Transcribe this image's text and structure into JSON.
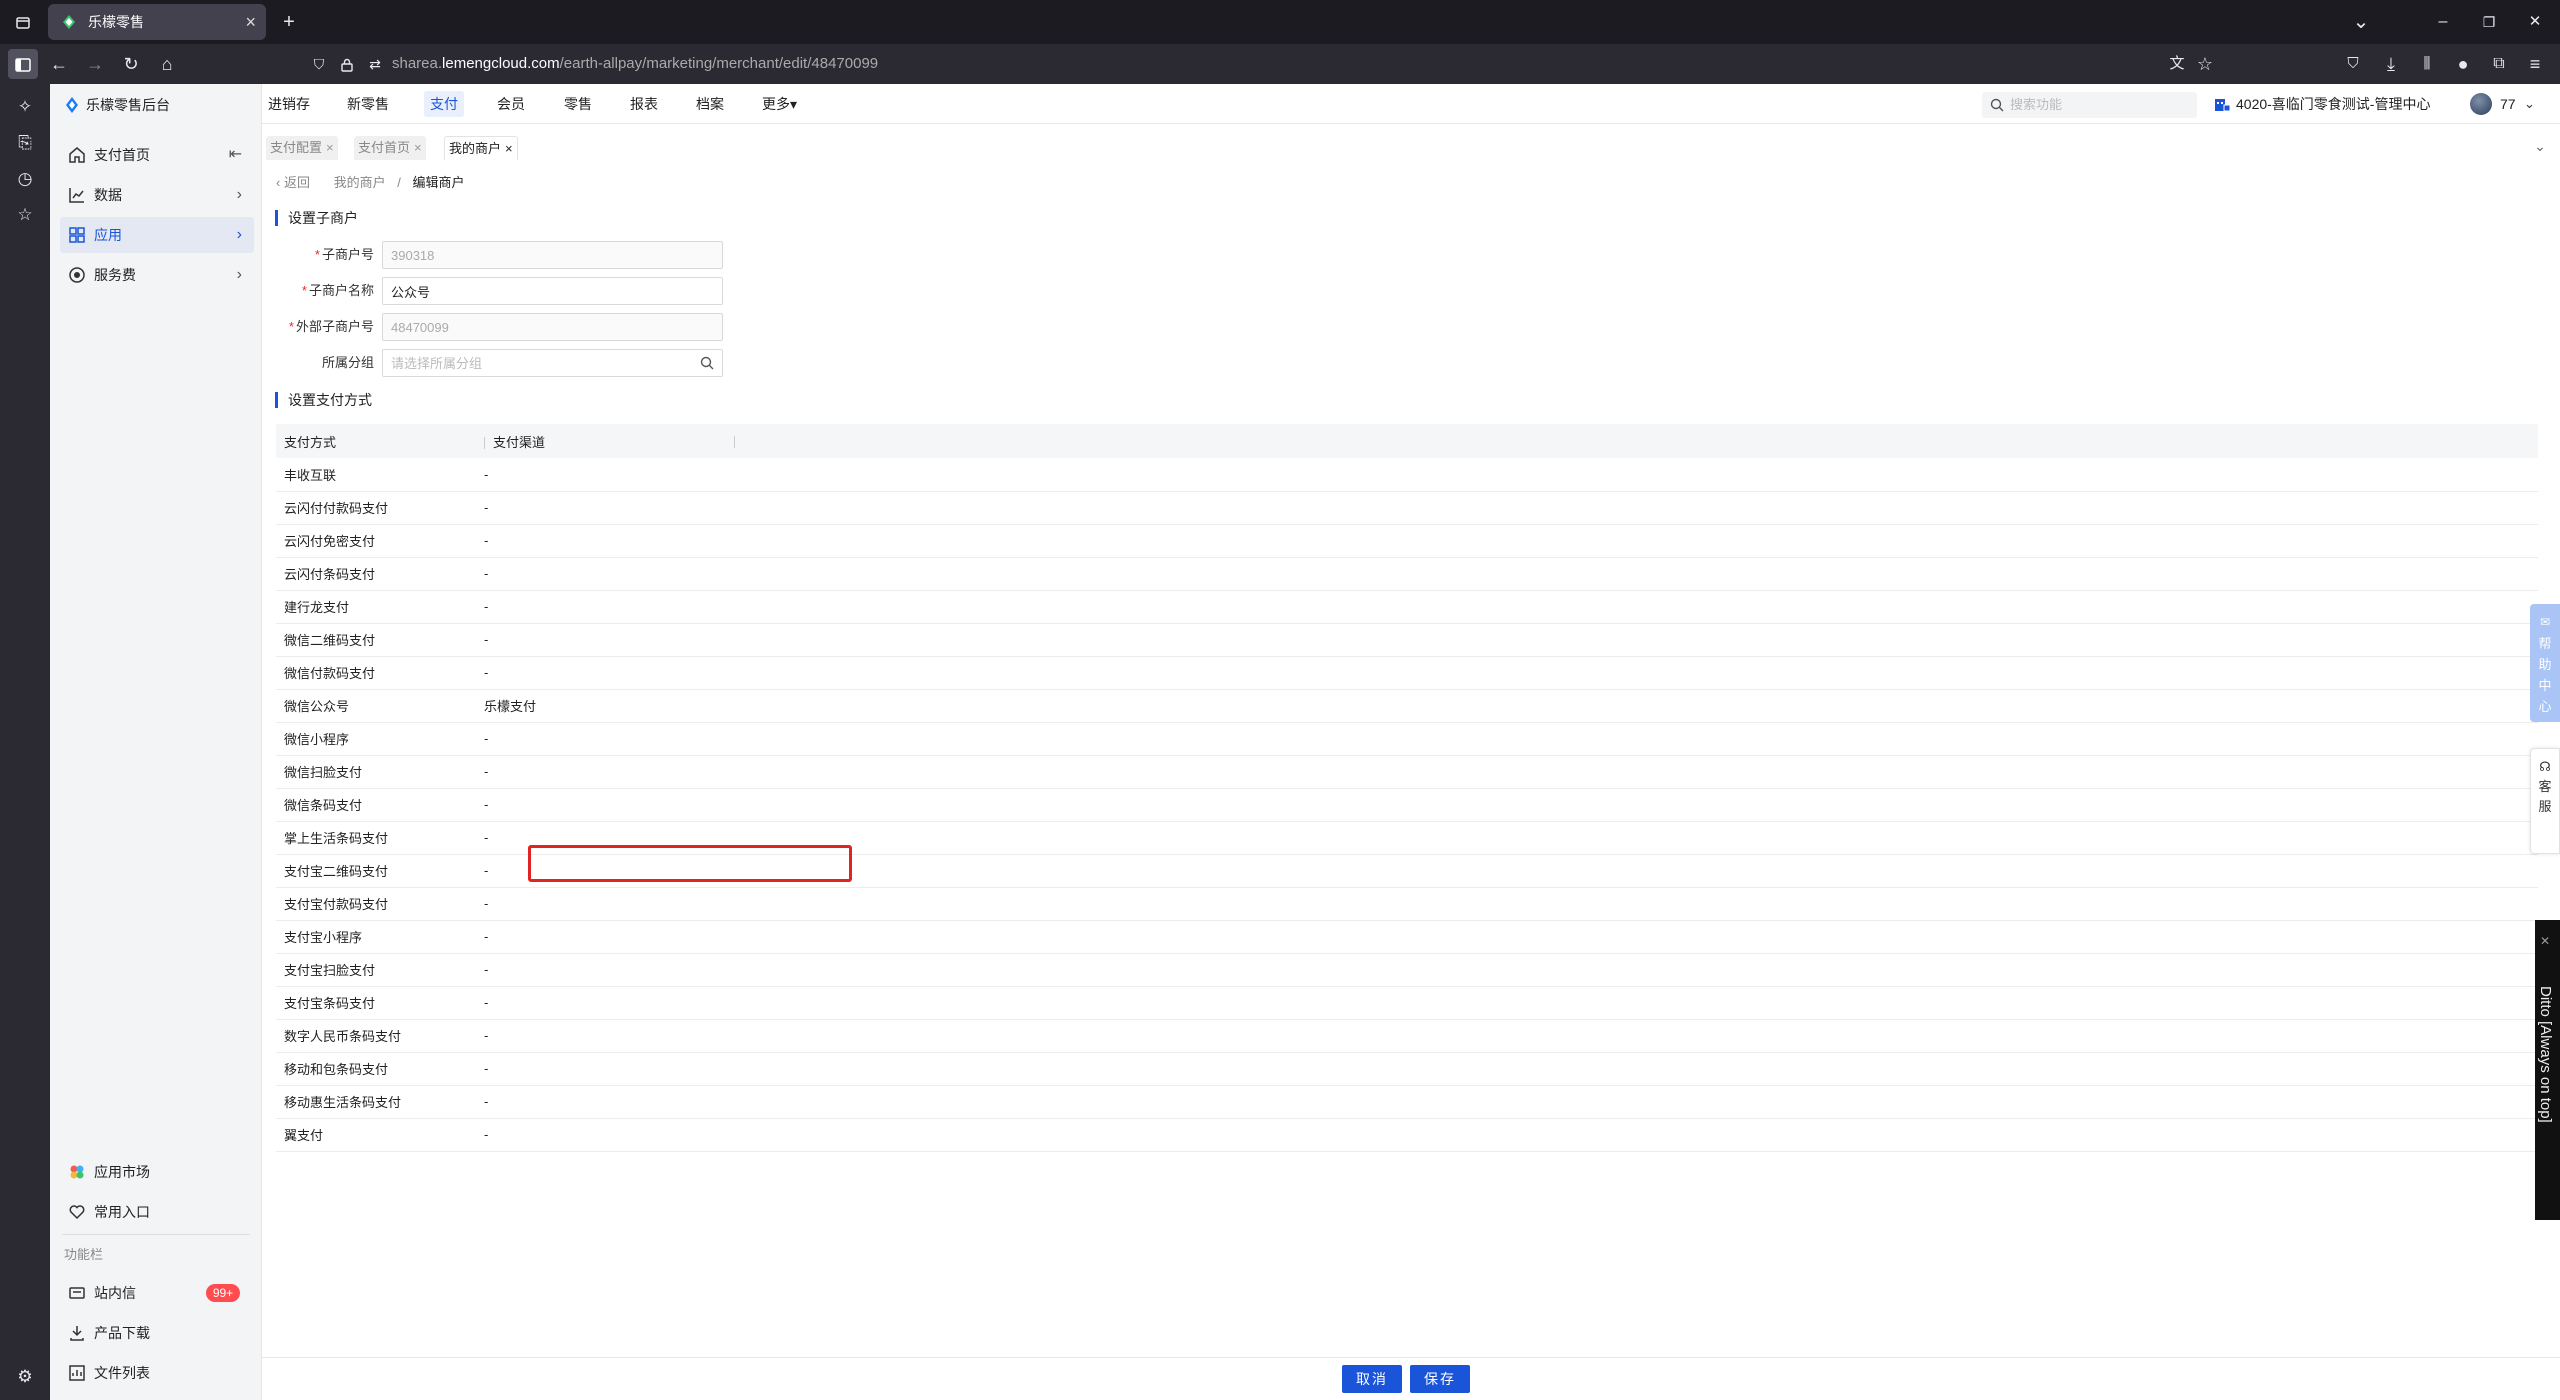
{
  "browser": {
    "tab_title": "乐檬零售",
    "tab_close": "×",
    "new_tab": "+",
    "url_prefix": "sharea.",
    "url_domain": "lemengcloud.com",
    "url_path": "/earth-allpay/marketing/merchant/edit/48470099",
    "tab_list_glyph": "⌄",
    "min_glyph": "–",
    "restore_glyph": "❐",
    "close_glyph": "✕"
  },
  "app": {
    "logo_text": "乐檬零售后台",
    "sidebar": {
      "items": [
        {
          "label": "支付首页",
          "arrow": "⇤",
          "icon": "home-icon"
        },
        {
          "label": "数据",
          "arrow": "›",
          "icon": "chart-icon"
        },
        {
          "label": "应用",
          "arrow": "›",
          "icon": "grid-icon",
          "active": true
        },
        {
          "label": "服务费",
          "arrow": "›",
          "icon": "coin-icon"
        }
      ],
      "bottom_items": [
        {
          "label": "应用市场",
          "icon": "market-icon"
        },
        {
          "label": "常用入口",
          "icon": "heart-icon"
        }
      ],
      "section_label": "功能栏",
      "function_items": [
        {
          "label": "站内信",
          "badge": "99+",
          "icon": "mail-icon"
        },
        {
          "label": "产品下载",
          "icon": "download-icon"
        },
        {
          "label": "文件列表",
          "icon": "file-list-icon"
        }
      ]
    },
    "header": {
      "nav": [
        "进销存",
        "新零售",
        "支付",
        "会员",
        "零售",
        "报表",
        "档案",
        "更多▾"
      ],
      "active_nav": "支付",
      "search_placeholder": "搜索功能",
      "store_name": "4020-喜临门零食测试-管理中心",
      "user_name": "77",
      "user_chevron": "⌄"
    },
    "page_tabs": [
      {
        "label": "支付配置",
        "close": "×"
      },
      {
        "label": "支付首页",
        "close": "×"
      },
      {
        "label": "我的商户",
        "close": "×",
        "active": true
      }
    ],
    "tabs_collapse": "⌄",
    "breadcrumb": {
      "back": "‹ 返回",
      "parent": "我的商户",
      "separator": "/",
      "current": "编辑商户"
    },
    "section1_title": "设置子商户",
    "form": {
      "sub_merchant_no": {
        "label": "子商户号",
        "value": "390318"
      },
      "sub_merchant_name": {
        "label": "子商户名称",
        "value": "公众号"
      },
      "external_no": {
        "label": "外部子商户号",
        "value": "48470099"
      },
      "group": {
        "label": "所属分组",
        "placeholder": "请选择所属分组"
      }
    },
    "section2_title": "设置支付方式",
    "table": {
      "headers": [
        "支付方式",
        "支付渠道"
      ],
      "rows": [
        {
          "method": "丰收互联",
          "channel": "-"
        },
        {
          "method": "云闪付付款码支付",
          "channel": "-"
        },
        {
          "method": "云闪付免密支付",
          "channel": "-"
        },
        {
          "method": "云闪付条码支付",
          "channel": "-"
        },
        {
          "method": "建行龙支付",
          "channel": "-"
        },
        {
          "method": "微信二维码支付",
          "channel": "-"
        },
        {
          "method": "微信付款码支付",
          "channel": "-"
        },
        {
          "method": "微信公众号",
          "channel": "乐檬支付"
        },
        {
          "method": "微信小程序",
          "channel": "-"
        },
        {
          "method": "微信扫脸支付",
          "channel": "-"
        },
        {
          "method": "微信条码支付",
          "channel": "-"
        },
        {
          "method": "掌上生活条码支付",
          "channel": "-"
        },
        {
          "method": "支付宝二维码支付",
          "channel": "-"
        },
        {
          "method": "支付宝付款码支付",
          "channel": "-"
        },
        {
          "method": "支付宝小程序",
          "channel": "-"
        },
        {
          "method": "支付宝扫脸支付",
          "channel": "-"
        },
        {
          "method": "支付宝条码支付",
          "channel": "-"
        },
        {
          "method": "数字人民币条码支付",
          "channel": "-"
        },
        {
          "method": "移动和包条码支付",
          "channel": "-"
        },
        {
          "method": "移动惠生活条码支付",
          "channel": "-"
        },
        {
          "method": "翼支付",
          "channel": "-"
        }
      ]
    },
    "footer": {
      "cancel": "取消",
      "save": "保存"
    },
    "help_widget": [
      "帮",
      "助",
      "中",
      "心"
    ],
    "service_widget": [
      "客",
      "服"
    ]
  },
  "ditto": {
    "text": "Ditto [Always on top]",
    "close": "✕"
  },
  "colors": {
    "accent": "#1a54d9",
    "highlight_border": "#e02424",
    "badge": "#ff4d4f"
  }
}
